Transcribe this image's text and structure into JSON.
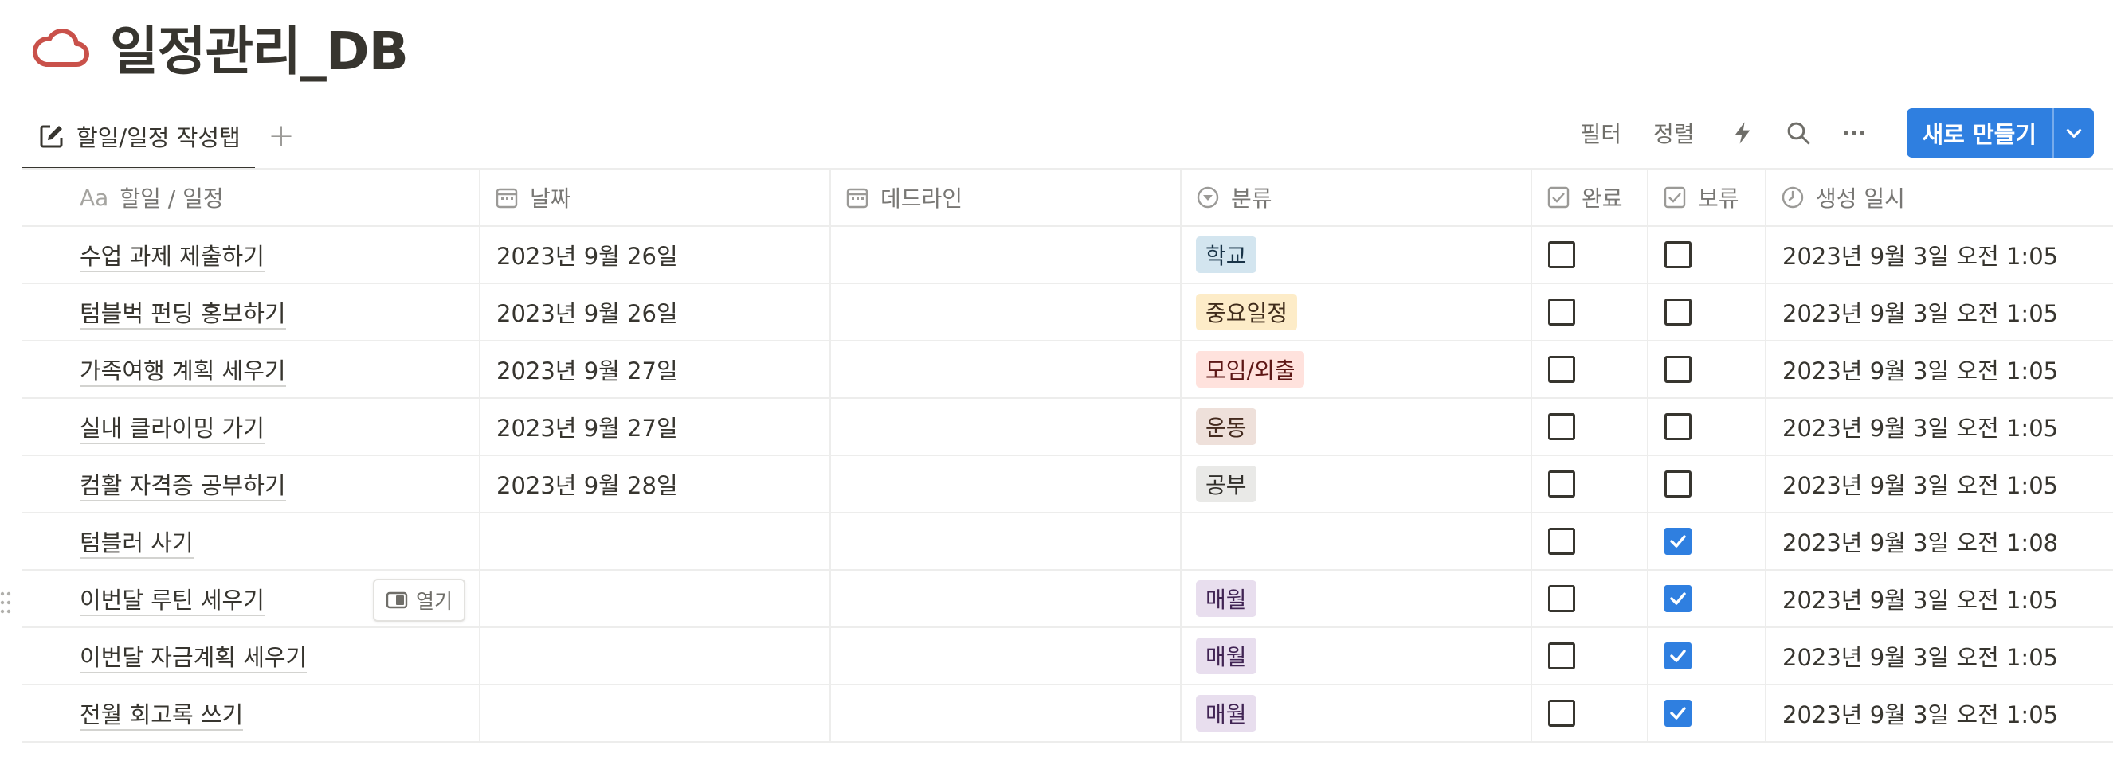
{
  "page": {
    "title": "일정관리_DB",
    "icon": "cloud-icon",
    "icon_color": "#c9514a"
  },
  "view": {
    "active_tab": "할일/일정 작성탭",
    "add_view": "+"
  },
  "toolbar": {
    "filter": "필터",
    "sort": "정렬",
    "new_button": "새로 만들기",
    "accent": "#2f7fe0"
  },
  "columns": [
    {
      "label": "할일 / 일정",
      "prefix": "Aa"
    },
    {
      "label": "날짜",
      "icon": "calendar-icon"
    },
    {
      "label": "데드라인",
      "icon": "calendar-icon"
    },
    {
      "label": "분류",
      "icon": "select-icon"
    },
    {
      "label": "완료",
      "icon": "checkbox-icon"
    },
    {
      "label": "보류",
      "icon": "checkbox-icon"
    },
    {
      "label": "생성 일시",
      "icon": "clock-icon"
    }
  ],
  "rows": [
    {
      "title": "수업 과제 제출하기",
      "date": "2023년 9월 26일",
      "deadline": "",
      "category": "학교",
      "done": false,
      "hold": false,
      "created": "2023년 9월 3일 오전 1:05"
    },
    {
      "title": "텀블벅 펀딩 홍보하기",
      "date": "2023년 9월 26일",
      "deadline": "",
      "category": "중요일정",
      "done": false,
      "hold": false,
      "created": "2023년 9월 3일 오전 1:05"
    },
    {
      "title": "가족여행 계획 세우기",
      "date": "2023년 9월 27일",
      "deadline": "",
      "category": "모임/외출",
      "done": false,
      "hold": false,
      "created": "2023년 9월 3일 오전 1:05"
    },
    {
      "title": "실내 클라이밍 가기",
      "date": "2023년 9월 27일",
      "deadline": "",
      "category": "운동",
      "done": false,
      "hold": false,
      "created": "2023년 9월 3일 오전 1:05"
    },
    {
      "title": "컴활 자격증 공부하기",
      "date": "2023년 9월 28일",
      "deadline": "",
      "category": "공부",
      "done": false,
      "hold": false,
      "created": "2023년 9월 3일 오전 1:05"
    },
    {
      "title": "텀블러 사기",
      "date": "",
      "deadline": "",
      "category": "",
      "done": false,
      "hold": true,
      "created": "2023년 9월 3일 오전 1:08"
    },
    {
      "title": "이번달 루틴 세우기",
      "date": "",
      "deadline": "",
      "category": "매월",
      "done": false,
      "hold": true,
      "created": "2023년 9월 3일 오전 1:05",
      "hover_open": "열기"
    },
    {
      "title": "이번달 자금계획 세우기",
      "date": "",
      "deadline": "",
      "category": "매월",
      "done": false,
      "hold": true,
      "created": "2023년 9월 3일 오전 1:05"
    },
    {
      "title": "전월 회고록 쓰기",
      "date": "",
      "deadline": "",
      "category": "매월",
      "done": false,
      "hold": true,
      "created": "2023년 9월 3일 오전 1:05"
    }
  ],
  "tag_colors": {
    "학교": {
      "bg": "#d3e5ef",
      "fg": "#183347"
    },
    "중요일정": {
      "bg": "#fdecc8",
      "fg": "#402c1b"
    },
    "모임/외출": {
      "bg": "#ffe2dd",
      "fg": "#5d1715"
    },
    "운동": {
      "bg": "#eee0da",
      "fg": "#442a1e"
    },
    "공부": {
      "bg": "#e9e9e7",
      "fg": "#32302c"
    },
    "매월": {
      "bg": "#e8deee",
      "fg": "#412454"
    }
  }
}
